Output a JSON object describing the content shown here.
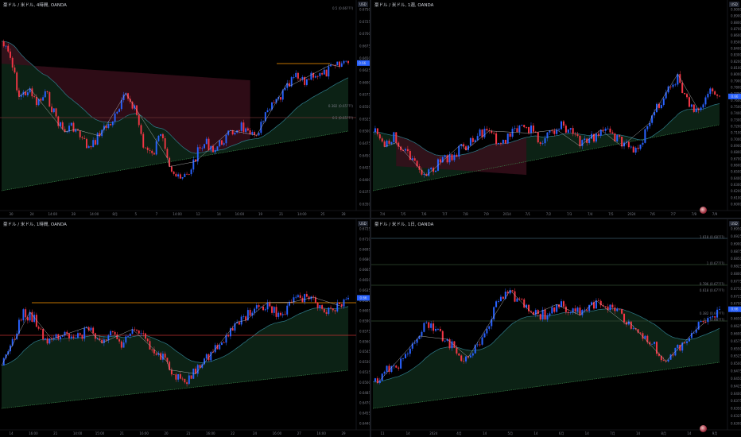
{
  "panes": [
    {
      "title": "豪ドル / 米ドル, 4時間, OANDA",
      "axis_button": "USD",
      "current_price": "0.66  ",
      "y_ticks": [
        "0.67500",
        "0.67250",
        "0.67000",
        "0.66750",
        "0.66500",
        "0.66250",
        "0.66000",
        "0.65750",
        "0.65500",
        "0.65250",
        "0.65000",
        "0.64750",
        "0.64500",
        "0.64250",
        "0.64000",
        "0.63750",
        "0.63500"
      ],
      "x_ticks": [
        "30",
        "24",
        "14:00",
        "28",
        "14:00",
        "8月",
        "5",
        "7",
        "14:00",
        "12",
        "14",
        "16:00",
        "19",
        "21",
        "14:00",
        "25",
        "28"
      ],
      "level_labels": [
        "0.5 (0.66???)",
        "0.382 (0.65???)",
        "0.5 (0.65???)"
      ]
    },
    {
      "title": "豪ドル / 米ドル, 1週, OANDA",
      "axis_button": "USD",
      "current_price": "0.66",
      "y_ticks": [
        "0.90000",
        "0.89000",
        "0.88000",
        "0.87000",
        "0.86000",
        "0.85000",
        "0.84000",
        "0.83000",
        "0.82000",
        "0.81000",
        "0.80000",
        "0.79000",
        "0.78000",
        "0.77000",
        "0.76000",
        "0.75000",
        "0.74000",
        "0.73000",
        "0.72000",
        "0.71000",
        "0.70000",
        "0.69000",
        "0.68000",
        "0.67000",
        "0.66000",
        "0.65000",
        "0.64000",
        "0.63000",
        "0.62000",
        "0.61000",
        "0.60000"
      ],
      "x_ticks": [
        "7/4",
        "7/5",
        "7/6",
        "7/7",
        "7/8",
        "7/9",
        "2014",
        "7/1",
        "7/2",
        "7/3",
        "7/4",
        "7/5",
        "2024",
        "7/6",
        "7/7",
        "7/8",
        "7/9"
      ]
    },
    {
      "title": "豪ドル / 米ドル, 1時間, OANDA",
      "axis_button": "USD",
      "current_price": "0.66",
      "y_ticks": [
        "0.67250",
        "0.67100",
        "0.66950",
        "0.66800",
        "0.66650",
        "0.66500",
        "0.66350",
        "0.66200",
        "0.66050",
        "0.65900",
        "0.65750",
        "0.65600",
        "0.65450",
        "0.65300",
        "0.65150",
        "0.65000",
        "0.64850",
        "0.64700",
        "0.64550",
        "0.64400"
      ],
      "x_ticks": [
        "14",
        "16:00",
        "21",
        "14:00",
        "15:00",
        "21",
        "16:00",
        "20",
        "21",
        "16:00",
        "22",
        "24",
        "16:00",
        "27",
        "16:00",
        "29"
      ]
    },
    {
      "title": "豪ドル / 米ドル, 1日, OANDA",
      "axis_button": "USD",
      "current_price": "0.66",
      "y_ticks": [
        "0.69500",
        "0.69250",
        "0.69000",
        "0.68750",
        "0.68500",
        "0.68250",
        "0.68000",
        "0.67750",
        "0.67500",
        "0.67250",
        "0.67000",
        "0.66750",
        "0.66500",
        "0.66250",
        "0.66000",
        "0.65750",
        "0.65500",
        "0.65250",
        "0.65000",
        "0.64750",
        "0.64500",
        "0.64250",
        "0.64000",
        "0.63750",
        "0.63500",
        "0.63250",
        "0.63000"
      ],
      "x_ticks": [
        "11",
        "14",
        "2024",
        "4月",
        "14",
        "5月",
        "14",
        "6月",
        "14",
        "7月",
        "14",
        "8月",
        "14",
        "9月"
      ],
      "level_labels": [
        "1.618 (0.68???)",
        "1 (0.67???)",
        "0.786 (0.67???)",
        "0.618 (0.67???)",
        "0.382 (0.66???)",
        "0.5 (0.66???)"
      ]
    }
  ],
  "colors": {
    "up": "#2962ff",
    "down": "#f23645",
    "ema": "#2f7d8c",
    "cloud_green": "#0f2a1a",
    "cloud_red": "#3a0f1c",
    "zigzag": "#d0d0d0",
    "price_tag": "#2962ff",
    "level": "#3d6b3d",
    "orange": "#ff9800"
  }
}
